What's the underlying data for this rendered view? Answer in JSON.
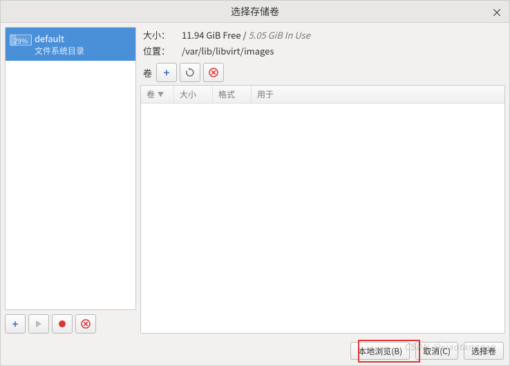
{
  "title": "选择存储卷",
  "close_x": "×",
  "sidebar": {
    "pools": [
      {
        "name": "default",
        "sub": "文件系统目录",
        "pct": "29%"
      }
    ]
  },
  "info": {
    "size_label": "大小：",
    "free": "11.94 GiB Free",
    "sep": " / ",
    "inuse": "5.05 GiB In Use",
    "loc_label": "位置：",
    "loc_path": "/var/lib/libvirt/images"
  },
  "vol_toolbar": {
    "label": "卷"
  },
  "columns": {
    "vol": "卷",
    "size": "大小",
    "fmt": "格式",
    "used": "用于"
  },
  "footer": {
    "browse": "本地浏览(B)",
    "cancel": "取消(C)",
    "choose": "选择卷"
  },
  "watermark": "CSDN @xiaotanggao"
}
